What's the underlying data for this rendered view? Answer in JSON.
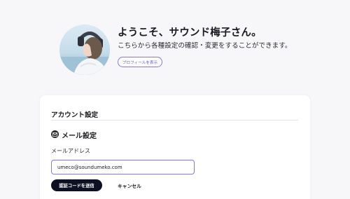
{
  "profile": {
    "greeting": "ようこそ、サウンド梅子さん。",
    "subtext": "こちらから各種設定の確認・変更をすることができます。",
    "view_profile_label": "プロフィールを表示"
  },
  "account": {
    "title": "アカウント設定",
    "mail_section": {
      "title": "メール設定",
      "icon": "mail-icon",
      "field_label": "メールアドレス",
      "email_value": "umeco@soundumeko.com",
      "send_code_label": "認証コードを送信",
      "cancel_label": "キャンセル"
    }
  },
  "colors": {
    "accent": "#8a78d6",
    "primary_button": "#0d1023",
    "background": "#f7f7f9"
  }
}
